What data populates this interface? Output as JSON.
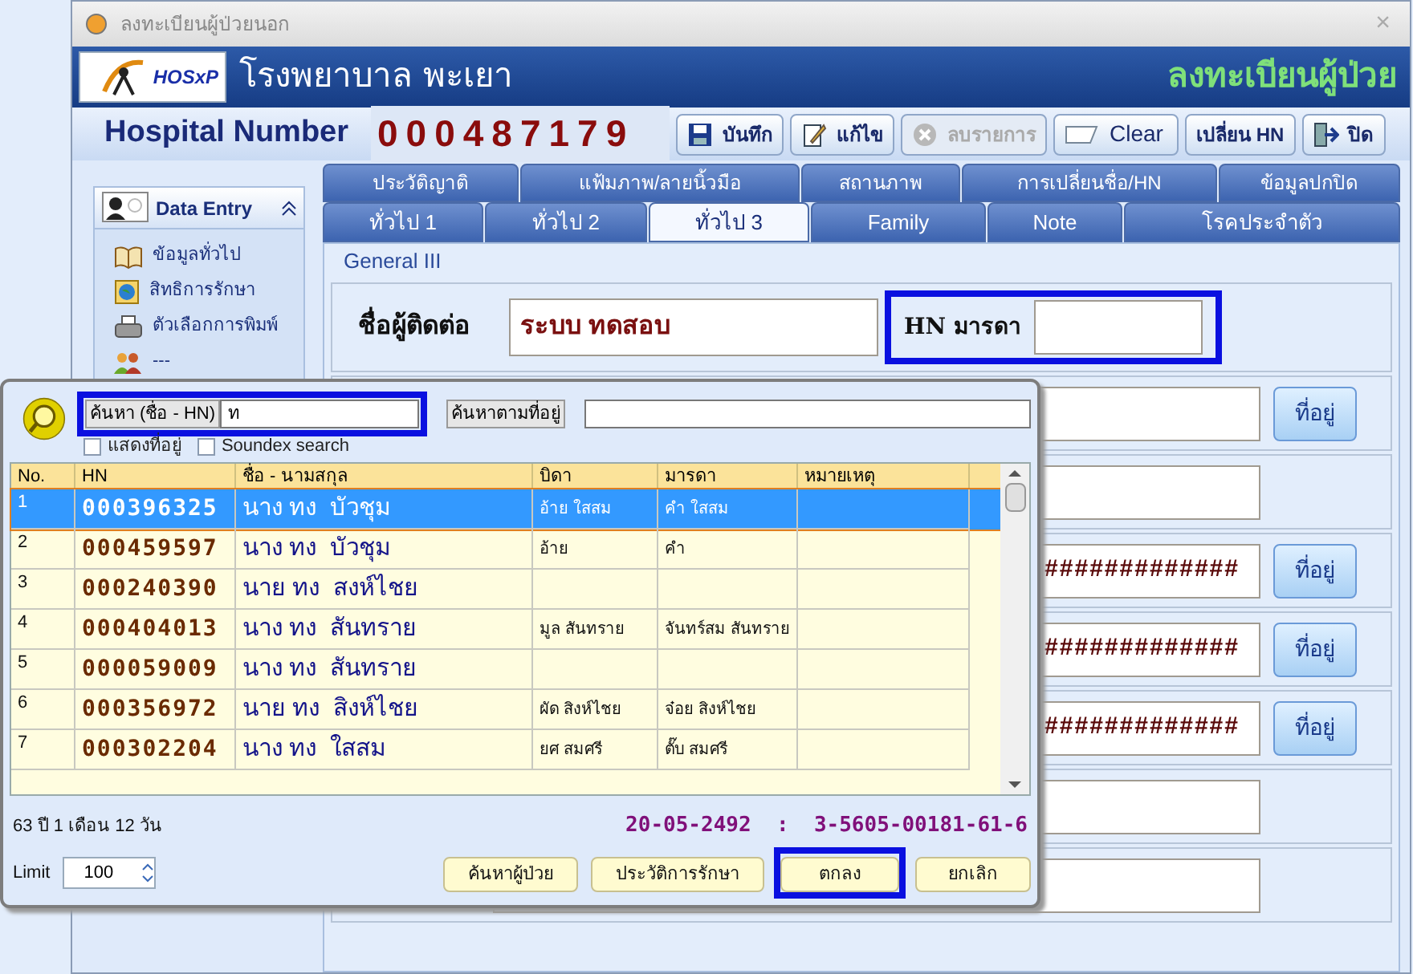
{
  "window": {
    "title": "ลงทะเบียนผู้ป่วยนอก",
    "close": "×"
  },
  "header": {
    "logo": "HOSxP",
    "hospital": "โรงพยาบาล พะเยา",
    "module": "ลงทะเบียนผู้ป่วย"
  },
  "toolbar": {
    "label": "Hospital Number",
    "number": "000487179",
    "buttons": [
      {
        "kind": "save",
        "label": "บันทึก",
        "disabled": false
      },
      {
        "kind": "edit",
        "label": "แก้ไข",
        "disabled": false
      },
      {
        "kind": "delete",
        "label": "ลบรายการ",
        "disabled": true
      },
      {
        "kind": "clear",
        "label": "Clear",
        "disabled": false
      },
      {
        "kind": "plain",
        "label": "เปลี่ยน HN",
        "disabled": false
      },
      {
        "kind": "exit",
        "label": "ปิด",
        "disabled": false
      }
    ]
  },
  "sidebar": {
    "title": "Data Entry",
    "items": [
      {
        "kind": "book",
        "label": "ข้อมูลทั่วไป"
      },
      {
        "kind": "card",
        "label": "สิทธิการรักษา"
      },
      {
        "kind": "printer",
        "label": "ตัวเลือกการพิมพ์"
      },
      {
        "kind": "people",
        "label": "---"
      }
    ]
  },
  "tabs_top": [
    {
      "label": "ประวัติญาติ",
      "selected": false
    },
    {
      "label": "แฟ้มภาพ/ลายนิ้วมือ",
      "selected": false
    },
    {
      "label": "สถานภาพ",
      "selected": false
    },
    {
      "label": "การเปลี่ยนชื่อ/HN",
      "selected": false
    },
    {
      "label": "ข้อมูลปกปิด",
      "selected": false
    }
  ],
  "tabs": [
    {
      "label": "ทั่วไป 1",
      "selected": false
    },
    {
      "label": "ทั่วไป 2",
      "selected": false
    },
    {
      "label": "ทั่วไป 3",
      "selected": true
    },
    {
      "label": "Family",
      "selected": false
    },
    {
      "label": "Note",
      "selected": false
    },
    {
      "label": "โรคประจำตัว",
      "selected": false
    }
  ],
  "panel": {
    "title": "General III",
    "contact_label": "ชื่อผู้ติดต่อ",
    "contact_value": "ระบบ  ทดสอบ",
    "mother_hn_label": "HN มารดา",
    "rows": [
      {
        "kind": "address",
        "button": "ที่อยู่"
      },
      {
        "kind": "plain"
      },
      {
        "kind": "address",
        "value": "#############",
        "button": "ที่อยู่"
      },
      {
        "kind": "address",
        "value": "#############",
        "button": "ที่อยู่"
      },
      {
        "kind": "address",
        "value": "#############",
        "button": "ที่อยู่"
      },
      {
        "kind": "plain"
      },
      {
        "kind": "plain"
      }
    ]
  },
  "dialog": {
    "search_label": "ค้นหา (ชื่อ - HN)",
    "search_value": "ท",
    "address_label": "ค้นหาตามที่อยู่",
    "checkboxes": [
      {
        "label": "แสดงที่อยู่",
        "checked": false
      },
      {
        "label": "Soundex search",
        "checked": false
      }
    ],
    "columns": [
      "No.",
      "HN",
      "ชื่อ - นามสกุล",
      "บิดา",
      "มารดา",
      "หมายเหตุ"
    ],
    "rows": [
      {
        "no": "1",
        "hn": "000396325",
        "name": "นาง ทง  บัวชุม",
        "father": "อ้าย ใสสม",
        "mother": "คำ ใสสม",
        "selected": true
      },
      {
        "no": "2",
        "hn": "000459597",
        "name": "นาง ทง  บัวชุม",
        "father": "อ้าย",
        "mother": "คำ",
        "selected": false
      },
      {
        "no": "3",
        "hn": "000240390",
        "name": "นาย ทง  สงห์ไชย",
        "selected": false
      },
      {
        "no": "4",
        "hn": "000404013",
        "name": "นาง ทง  สันทราย",
        "father": "มูล สันทราย",
        "mother": "จันทร์สม สันทราย",
        "selected": false
      },
      {
        "no": "5",
        "hn": "000059009",
        "name": "นาง ทง  สันทราย",
        "selected": false
      },
      {
        "no": "6",
        "hn": "000356972",
        "name": "นาย ทง  สิงห์ไชย",
        "father": "ผัด สิงห์ไชย",
        "mother": "จ๋อย สิงห์ไชย",
        "selected": false
      },
      {
        "no": "7",
        "hn": "000302204",
        "name": "นาง ทง  ใสสม",
        "father": "ยศ สมศรี",
        "mother": "ตั๊บ สมศรี",
        "selected": false
      }
    ],
    "age": "63 ปี 1 เดือน 12 วัน",
    "birth_id": "20-05-2492  :  3-5605-00181-61-6",
    "limit_label": "Limit",
    "limit_value": "100",
    "buttons": [
      "ค้นหาผู้ป่วย",
      "ประวัติการรักษา",
      "ตกลง",
      "ยกเลิก"
    ]
  }
}
